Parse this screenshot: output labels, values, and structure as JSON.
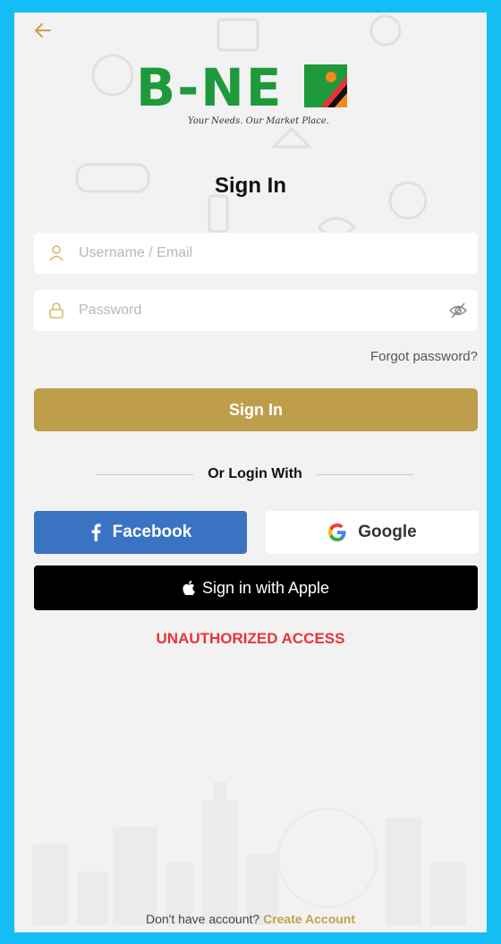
{
  "header": {
    "back_icon": "arrow-left-icon"
  },
  "logo": {
    "text": "B-NE",
    "tagline": "Your Needs. Our Market Place."
  },
  "title": "Sign In",
  "form": {
    "username_placeholder": "Username / Email",
    "password_placeholder": "Password",
    "username_icon": "user-icon",
    "password_icon": "lock-icon",
    "visibility_icon": "eye-slash-icon",
    "forgot_label": "Forgot password?",
    "submit_label": "Sign In"
  },
  "social": {
    "divider_label": "Or Login With",
    "facebook_label": "Facebook",
    "google_label": "Google",
    "apple_label": "Sign in with Apple"
  },
  "status": {
    "message": "UNAUTHORIZED ACCESS"
  },
  "footer": {
    "prompt": "Don't have account?",
    "create_label": "Create Account"
  },
  "colors": {
    "border": "#14bdf3",
    "background": "#f2f2f2",
    "primary_gold": "#bf9e4b",
    "facebook_blue": "#3a73c2",
    "apple_black": "#000000",
    "error_red": "#e8343a",
    "logo_green": "#1e9a3c"
  }
}
